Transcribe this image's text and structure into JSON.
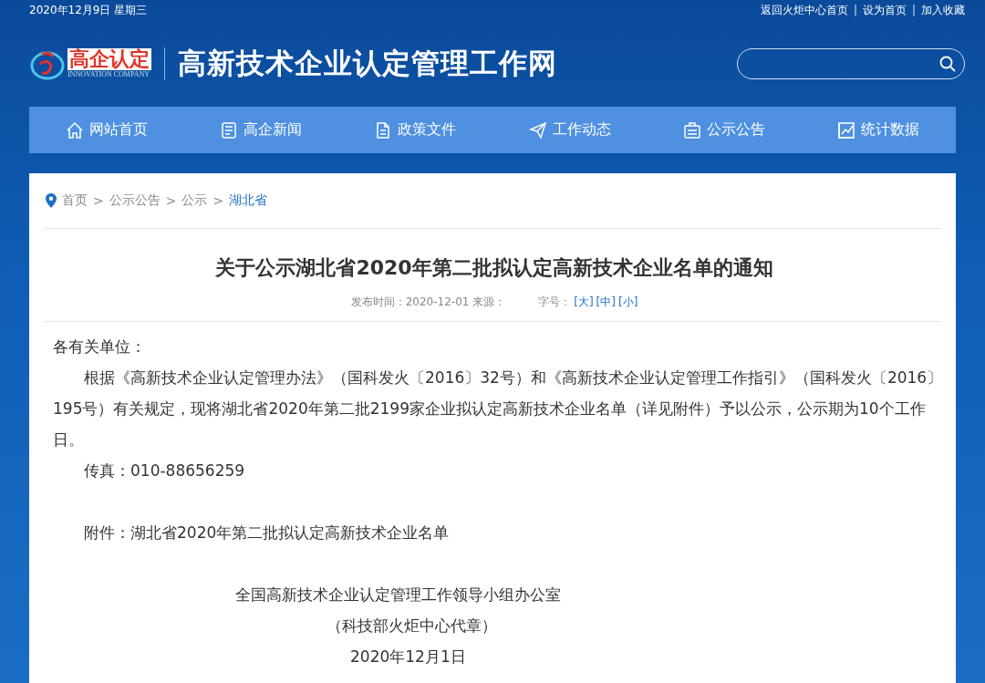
{
  "top_bar": {
    "date": "2020年12月9日 星期三",
    "links": [
      "返回火炬中心首页",
      "设为首页",
      "加入收藏"
    ],
    "separator": "|"
  },
  "header": {
    "logo_text": "高企认定",
    "logo_subtext": "INNOVATION COMPANY",
    "site_title": "高新技术企业认定管理工作网"
  },
  "nav": [
    {
      "label": "网站首页",
      "kind": "home"
    },
    {
      "label": "高企新闻",
      "kind": "news"
    },
    {
      "label": "政策文件",
      "kind": "doc"
    },
    {
      "label": "工作动态",
      "kind": "plane"
    },
    {
      "label": "公示公告",
      "kind": "board"
    },
    {
      "label": "统计数据",
      "kind": "chart"
    }
  ],
  "breadcrumb": [
    "首页",
    "公示公告",
    "公示",
    "湖北省"
  ],
  "breadcrumb_separator": ">",
  "article": {
    "title": "关于公示湖北省2020年第二批拟认定高新技术企业名单的通知",
    "meta": "发布时间：2020-12-01 来源：",
    "font_size_label": "字号：",
    "font_sizes": [
      "[大]",
      "[中]",
      "[小]"
    ],
    "salutation": "各有关单位：",
    "body": "根据《高新技术企业认定管理办法》（国科发火〔2016〕32号）和《高新技术企业认定管理工作指引》（国科发火〔2016〕195号）有关规定，现将湖北省2020年第二批2199家企业拟认定高新技术企业名单（详见附件）予以公示，公示期为10个工作日。",
    "fax": "传真：010-88656259",
    "attachment": "附件：湖北省2020年第二批拟认定高新技术企业名单",
    "signature": [
      "全国高新技术企业认定管理工作领导小组办公室",
      "（科技部火炬中心代章）",
      "2020年12月1日"
    ]
  }
}
